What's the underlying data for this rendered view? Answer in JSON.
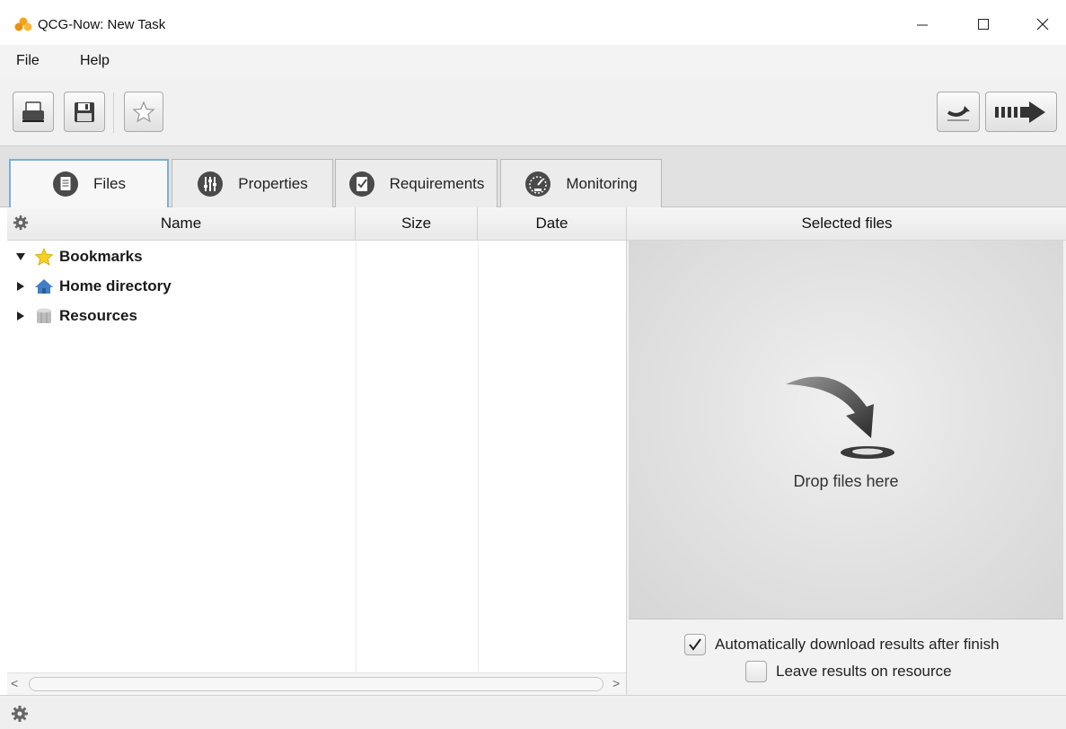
{
  "window": {
    "title": "QCG-Now: New Task"
  },
  "menu": {
    "file": "File",
    "help": "Help"
  },
  "toolbar": {
    "buttons": [
      "print-icon",
      "save-icon",
      "star-icon",
      "refresh-icon",
      "submit-icon"
    ]
  },
  "tabs": [
    {
      "label": "Files",
      "icon": "document-icon",
      "active": true
    },
    {
      "label": "Properties",
      "icon": "sliders-icon"
    },
    {
      "label": "Requirements",
      "icon": "checklist-icon"
    },
    {
      "label": "Monitoring",
      "icon": "gauge-icon"
    }
  ],
  "file_table": {
    "columns": {
      "name": "Name",
      "size": "Size",
      "date": "Date"
    },
    "rows": [
      {
        "label": "Bookmarks",
        "icon": "star-icon",
        "expanded": true
      },
      {
        "label": "Home directory",
        "icon": "home-icon",
        "expanded": false
      },
      {
        "label": "Resources",
        "icon": "database-icon",
        "expanded": false
      }
    ]
  },
  "selected_files": {
    "header": "Selected files",
    "drop_label": "Drop files here"
  },
  "options": {
    "auto_download": {
      "label": "Automatically download results after finish",
      "checked": true
    },
    "leave_results": {
      "label": "Leave results on resource",
      "checked": false
    }
  },
  "colors": {
    "accent": "#7ab0d8",
    "drop_bg": "#dcdcdc"
  }
}
